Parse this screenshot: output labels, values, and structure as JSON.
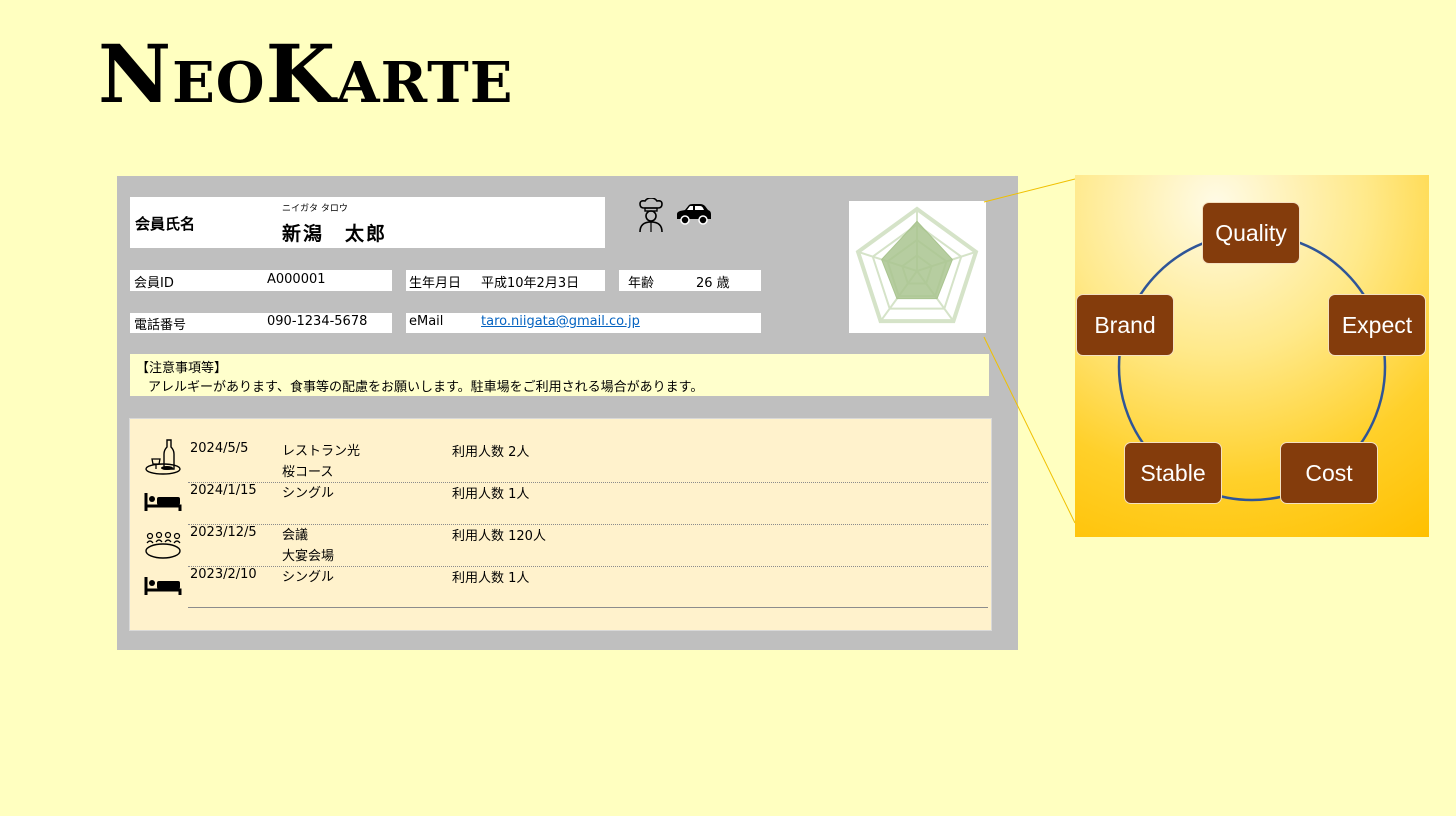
{
  "app": {
    "title": "NeoKarte"
  },
  "member": {
    "name_label": "会員氏名",
    "name_kana": "ニイガタ タロウ",
    "name": "新潟　太郎",
    "id_label": "会員ID",
    "id": "A000001",
    "birth_label": "生年月日",
    "birth": "平成10年2月3日",
    "age_label": "年齢",
    "age": "26 歳",
    "phone_label": "電話番号",
    "phone": "090-1234-5678",
    "email_label": "eMail",
    "email": "taro.niigata@gmail.co.jp"
  },
  "icons": {
    "chef": "chef-icon",
    "car": "car-icon"
  },
  "notes": {
    "title": "【注意事項等】",
    "text": "アレルギーがあります、食事等の配慮をお願いします。駐車場をご利用される場合があります。"
  },
  "history": [
    {
      "icon": "dining-icon",
      "date": "2024/5/5",
      "service": "レストラン光",
      "detail": "桜コース",
      "count": "利用人数 2人"
    },
    {
      "icon": "bed-icon",
      "date": "2024/1/15",
      "service": "シングル",
      "detail": "",
      "count": "利用人数 1人"
    },
    {
      "icon": "meeting-icon",
      "date": "2023/12/5",
      "service": "会議",
      "detail": "大宴会場",
      "count": "利用人数 120人"
    },
    {
      "icon": "bed-icon",
      "date": "2023/2/10",
      "service": "シングル",
      "detail": "",
      "count": "利用人数 1人"
    }
  ],
  "radar": {
    "axes": 5,
    "values": [
      0.8,
      0.6,
      0.55,
      0.55,
      0.6
    ],
    "max": 1,
    "fill_color": "#a9c48f",
    "grid_color": "#d5e3c8"
  },
  "cycle": {
    "nodes": [
      "Quality",
      "Expect",
      "Cost",
      "Stable",
      "Brand"
    ],
    "node_color": "#843c0c",
    "ring_color": "#2f5597"
  }
}
